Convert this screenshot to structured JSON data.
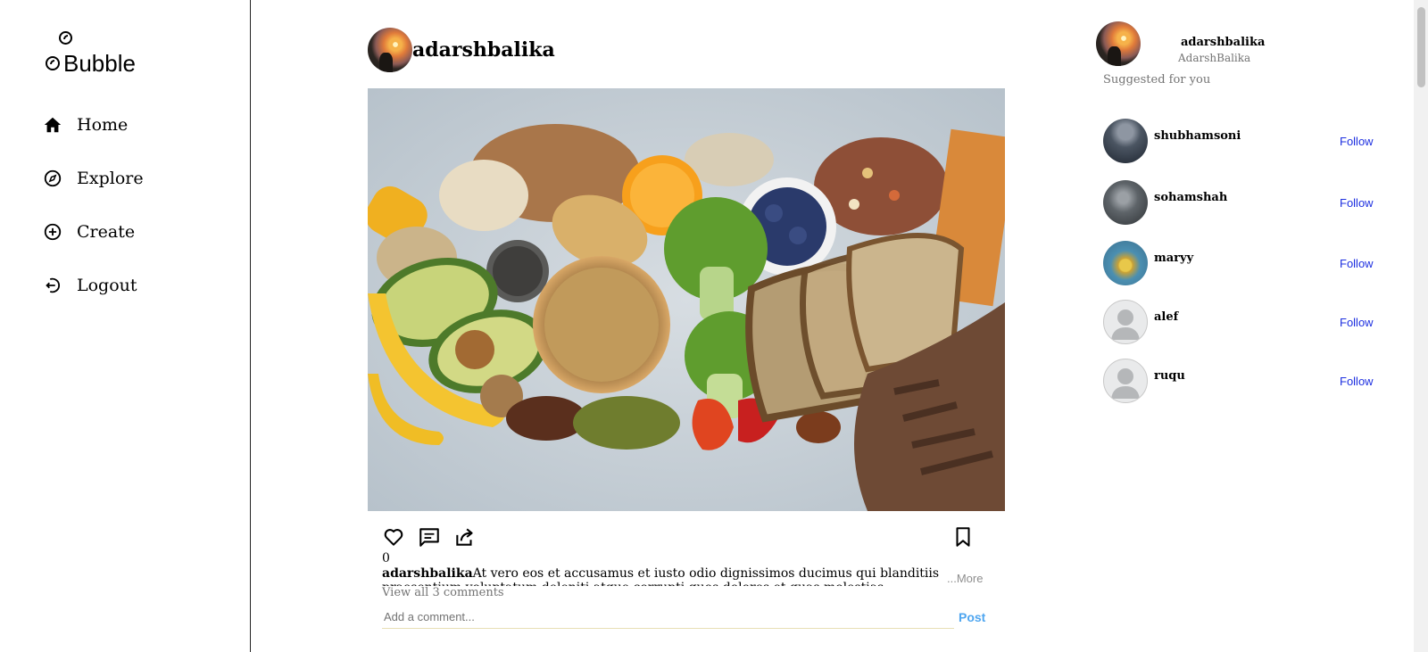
{
  "app": {
    "logo_text": "Bubble"
  },
  "nav": {
    "items": [
      {
        "label": "Home",
        "icon": "home-icon"
      },
      {
        "label": "Explore",
        "icon": "compass-icon"
      },
      {
        "label": "Create",
        "icon": "plus-circle-icon"
      },
      {
        "label": "Logout",
        "icon": "logout-icon"
      }
    ]
  },
  "post": {
    "username": "adarshbalika",
    "image_alt": "healthy food",
    "likes": "0",
    "caption_user": "adarshbalika",
    "caption_text": "At vero eos et accusamus et iusto odio dignissimos ducimus qui blanditiis praesentium voluptatum deleniti atque corrupti quos dolores et quas molestias excepturi",
    "more_label": "...More",
    "view_comments": "View all 3 comments",
    "comment_placeholder": "Add a comment...",
    "post_label": "Post"
  },
  "profile": {
    "username": "adarshbalika",
    "full_name": "AdarshBalika"
  },
  "suggestions": {
    "title": "Suggested for you",
    "follow_label": "Follow",
    "users": [
      {
        "username": "shubhamsoni"
      },
      {
        "username": "sohamshah"
      },
      {
        "username": "maryy"
      },
      {
        "username": "alef"
      },
      {
        "username": "ruqu"
      }
    ]
  },
  "colors": {
    "follow": "#1d2fe0",
    "post": "#4fa6f0"
  }
}
